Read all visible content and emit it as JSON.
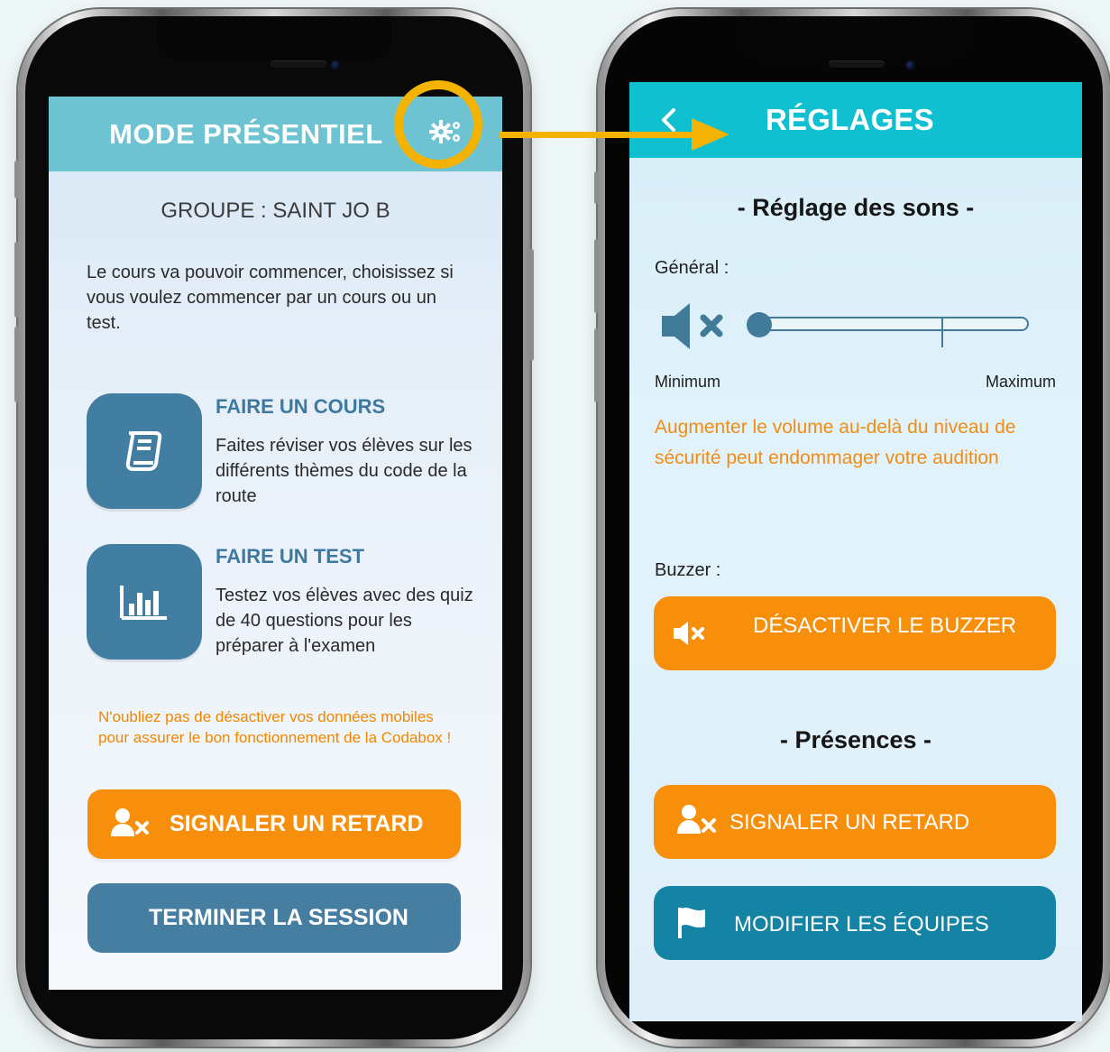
{
  "left_screen": {
    "header_title": "MODE PRÉSENTIEL",
    "group_label": "GROUPE : SAINT JO B",
    "intro_text": "Le cours va pouvoir commencer, choisissez si vous voulez commencer par un cours ou un test.",
    "course": {
      "title": "FAIRE UN COURS",
      "description": "Faites réviser vos élèves sur les différents thèmes du code de la route"
    },
    "test": {
      "title": "FAIRE UN TEST",
      "description": "Testez vos élèves avec des quiz de 40 questions pour les préparer à l'examen"
    },
    "notice": "N'oubliez pas de désactiver vos données mobiles pour assurer le bon fonctionnement de la Codabox !",
    "buttons": {
      "report_late": "SIGNALER UN RETARD",
      "end_session": "TERMINER LA SESSION"
    }
  },
  "right_screen": {
    "header_title": "RÉGLAGES",
    "sections": {
      "sounds": "- Réglage des sons -",
      "presences": "- Présences -"
    },
    "labels": {
      "general": "Général :",
      "buzzer": "Buzzer :",
      "minimum": "Minimum",
      "maximum": "Maximum"
    },
    "warning": "Augmenter le volume au-delà du niveau de sécurité peut endommager votre audition",
    "buttons": {
      "disable_buzzer": "DÉSACTIVER LE BUZZER",
      "report_late": "SIGNALER UN RETARD",
      "modify_teams": "MODIFIER LES ÉQUIPES"
    },
    "volume_fraction": 0.0
  },
  "colors": {
    "left_header": "#6dc3d2",
    "right_header": "#10c0d1",
    "orange": "#f78f0d",
    "blue": "#457ea0",
    "teal_blue": "#1583a4",
    "highlight": "#f3b300"
  },
  "icons": {
    "settings": "gear-icon",
    "back": "back-arrow-icon",
    "course": "book-icon",
    "test": "bar-chart-icon",
    "user_late": "user-x-icon",
    "mute": "mute-icon",
    "flag": "flag-icon"
  }
}
